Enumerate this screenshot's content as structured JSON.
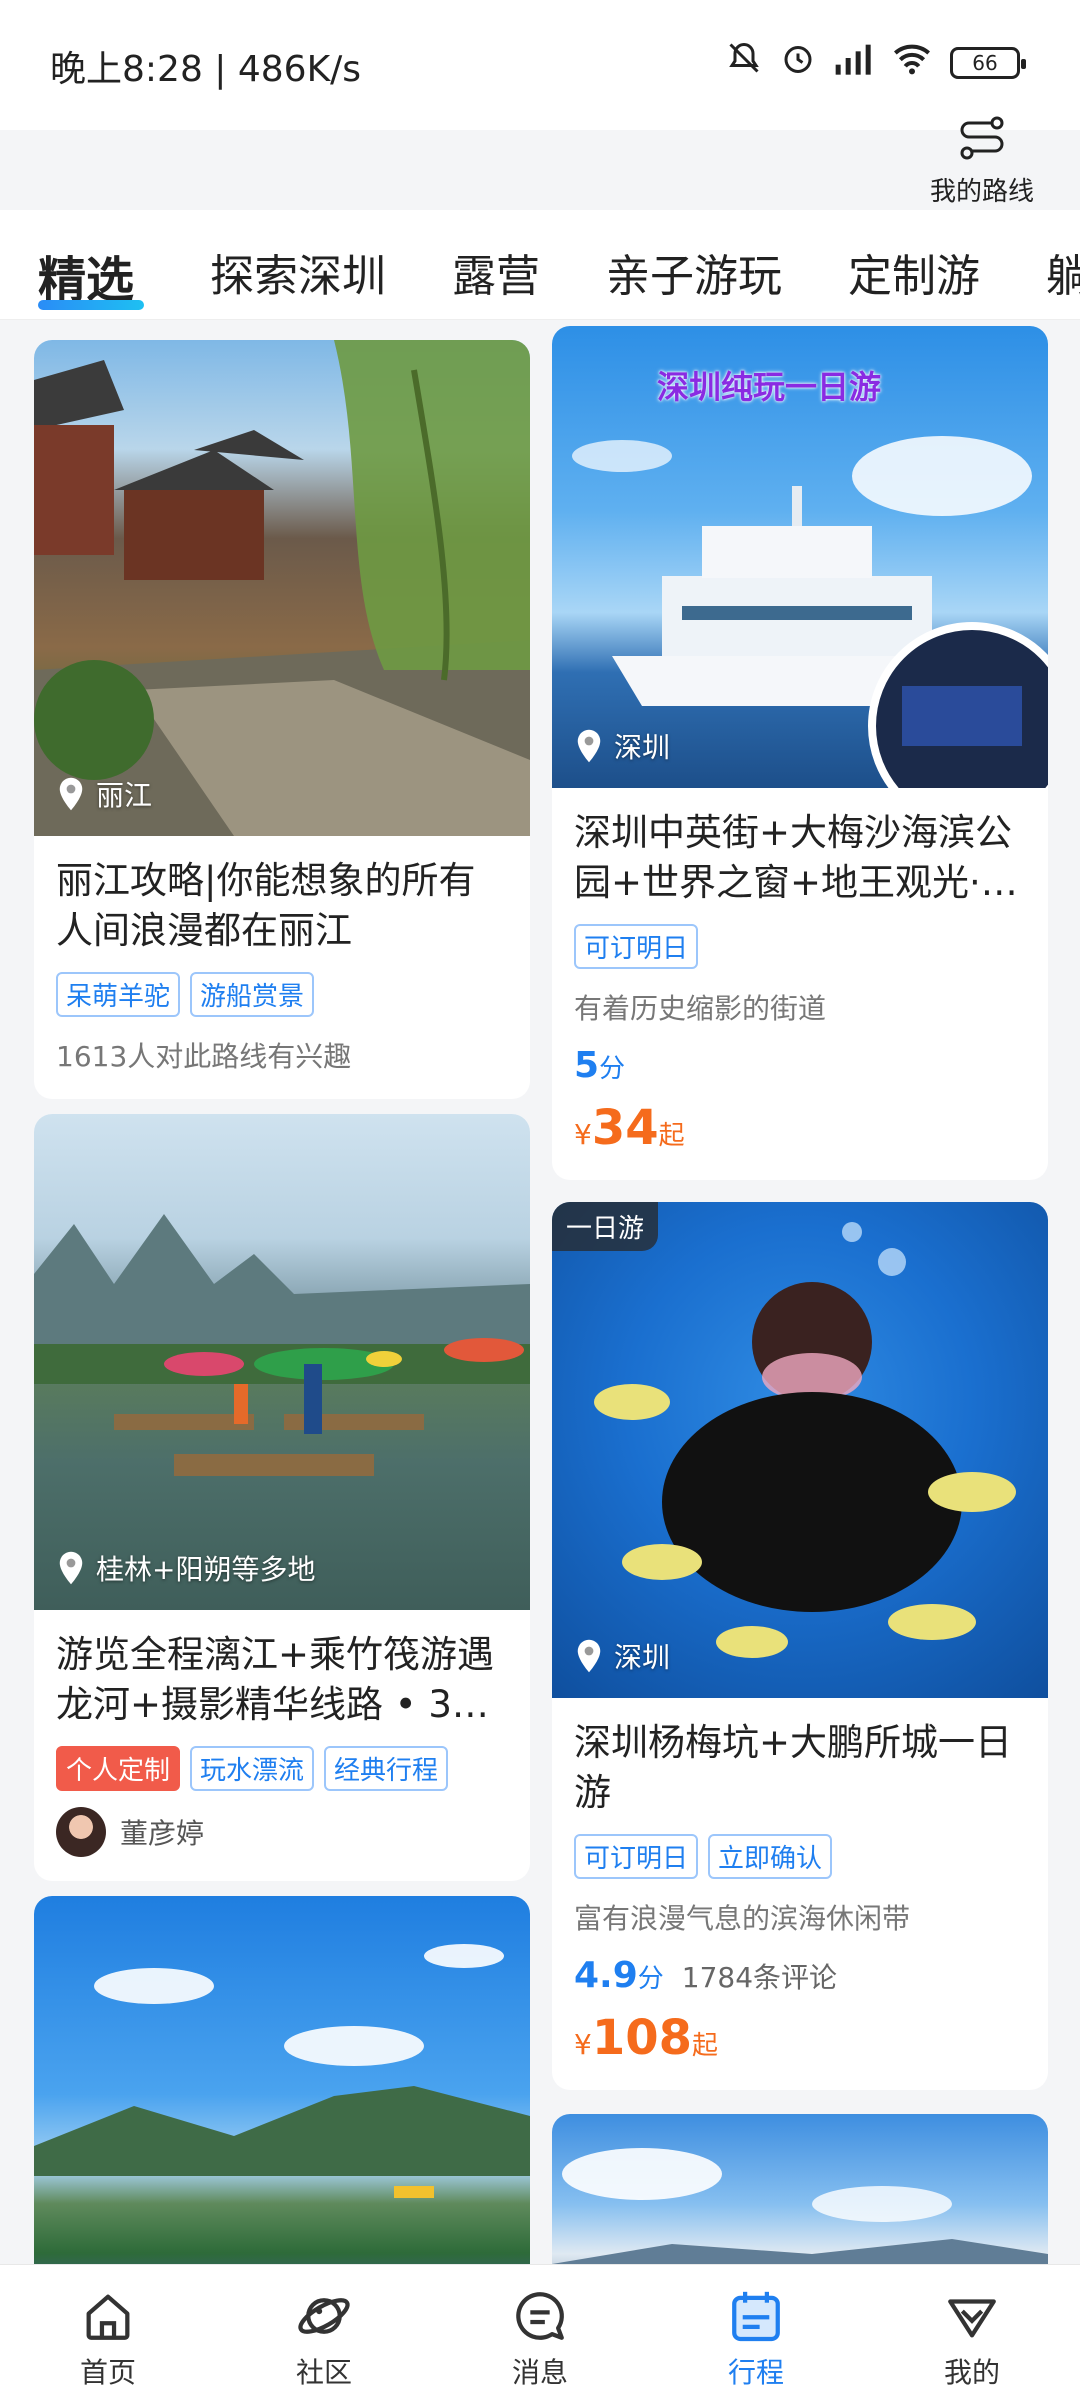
{
  "status_bar": {
    "time": "晚上8:28 | 486K/s",
    "battery": "66"
  },
  "header": {
    "route_label": "我的路线"
  },
  "tabs": [
    {
      "label": "精选"
    },
    {
      "label": "探索深圳"
    },
    {
      "label": "露营"
    },
    {
      "label": "亲子游玩"
    },
    {
      "label": "定制游"
    },
    {
      "label": "躺"
    }
  ],
  "feed": {
    "left": [
      {
        "location": "丽江",
        "title": "丽江攻略|你能想象的所有人间浪漫都在丽江",
        "tags": [
          "呆萌羊驼",
          "游船赏景"
        ],
        "subtext": "1613人对此路线有兴趣"
      },
      {
        "location": "桂林+阳朔等多地",
        "title": "游览全程漓江+乘竹筏游遇龙河+摄影精华线路 • 3…",
        "tags": [
          "个人定制",
          "玩水漂流",
          "经典行程"
        ],
        "author": "董彦婷"
      },
      {
        "location": ""
      }
    ],
    "right": [
      {
        "image_caption": "深圳纯玩一日游",
        "location": "深圳",
        "title": "深圳中英街+大梅沙海滨公园+世界之窗+地王观光·…",
        "tags": [
          "可订明日"
        ],
        "subtext": "有着历史缩影的街道",
        "score": "5",
        "score_unit": "分",
        "price_symbol": "¥",
        "price": "34",
        "price_suffix": "起"
      },
      {
        "corner_tag": "一日游",
        "location": "深圳",
        "title": "深圳杨梅坑+大鹏所城一日游",
        "tags": [
          "可订明日",
          "立即确认"
        ],
        "subtext": "富有浪漫气息的滨海休闲带",
        "score": "4.9",
        "score_unit": "分",
        "reviews": "1784条评论",
        "price_symbol": "¥",
        "price": "108",
        "price_suffix": "起"
      }
    ]
  },
  "bottom_nav": [
    {
      "label": "首页",
      "icon": "home-icon"
    },
    {
      "label": "社区",
      "icon": "planet-icon"
    },
    {
      "label": "消息",
      "icon": "message-icon"
    },
    {
      "label": "行程",
      "icon": "itinerary-icon",
      "active": true
    },
    {
      "label": "我的",
      "icon": "profile-icon"
    }
  ],
  "colors": {
    "accent": "#1f7ff0",
    "price": "#f56b1c",
    "red_tag": "#f15b4a"
  }
}
